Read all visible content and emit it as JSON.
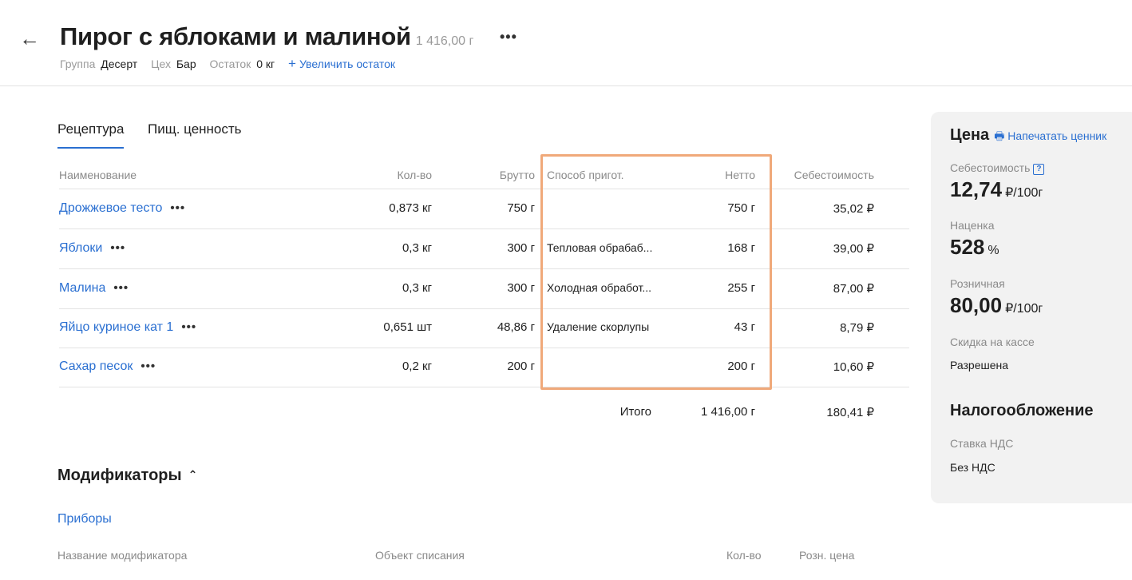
{
  "header": {
    "back_icon": "←",
    "title": "Пирог с яблоками и малиной",
    "weight": "1 416,00 г",
    "more_icon": "•••",
    "group_label": "Группа",
    "group_value": "Десерт",
    "workshop_label": "Цех",
    "workshop_value": "Бар",
    "stock_label": "Остаток",
    "stock_value": "0 кг",
    "increase_icon": "+",
    "increase_label": "Увеличить остаток"
  },
  "tabs": [
    {
      "label": "Рецептура",
      "active": true
    },
    {
      "label": "Пищ. ценность",
      "active": false
    }
  ],
  "table": {
    "headers": {
      "name": "Наименование",
      "qty": "Кол-во",
      "gross": "Брутто",
      "method": "Способ пригот.",
      "net": "Нетто",
      "cost": "Себестоимость"
    },
    "more_icon": "•••",
    "rows": [
      {
        "name": "Дрожжевое тесто",
        "qty": "0,873 кг",
        "gross": "750 г",
        "method": "",
        "net": "750 г",
        "cost": "35,02 ₽"
      },
      {
        "name": "Яблоки",
        "qty": "0,3 кг",
        "gross": "300 г",
        "method": "Тепловая обрабаб...",
        "net": "168 г",
        "cost": "39,00 ₽"
      },
      {
        "name": "Малина",
        "qty": "0,3 кг",
        "gross": "300 г",
        "method": "Холодная обработ...",
        "net": "255 г",
        "cost": "87,00 ₽"
      },
      {
        "name": "Яйцо куриное кат 1",
        "qty": "0,651 шт",
        "gross": "48,86 г",
        "method": "Удаление скорлупы",
        "net": "43 г",
        "cost": "8,79 ₽"
      },
      {
        "name": "Сахар песок",
        "qty": "0,2 кг",
        "gross": "200 г",
        "method": "",
        "net": "200 г",
        "cost": "10,60 ₽"
      }
    ],
    "total": {
      "label": "Итого",
      "net": "1 416,00 г",
      "cost": "180,41 ₽"
    }
  },
  "modifiers": {
    "title": "Модификаторы",
    "chevron_icon": "⌃",
    "group": "Приборы",
    "headers": {
      "name": "Название модификатора",
      "object": "Объект списания",
      "qty": "Кол-во",
      "price": "Розн. цена"
    }
  },
  "price_panel": {
    "title": "Цена",
    "print_icon": "🖶",
    "print_label": "Напечатать ценник",
    "cost_label": "Себестоимость",
    "help_icon": "?",
    "cost_value": "12,74",
    "cost_unit": "₽/100г",
    "markup_label": "Наценка",
    "markup_value": "528",
    "markup_unit": "%",
    "retail_label": "Розничная",
    "retail_value": "80,00",
    "retail_unit": "₽/100г",
    "discount_label": "Скидка на кассе",
    "discount_value": "Разрешена",
    "tax_title": "Налогообложение",
    "vat_label": "Ставка НДС",
    "vat_value": "Без НДС"
  },
  "colors": {
    "accent": "#2a6fd1",
    "highlight": "#f0a97a",
    "panel_bg": "#f2f2f2"
  }
}
